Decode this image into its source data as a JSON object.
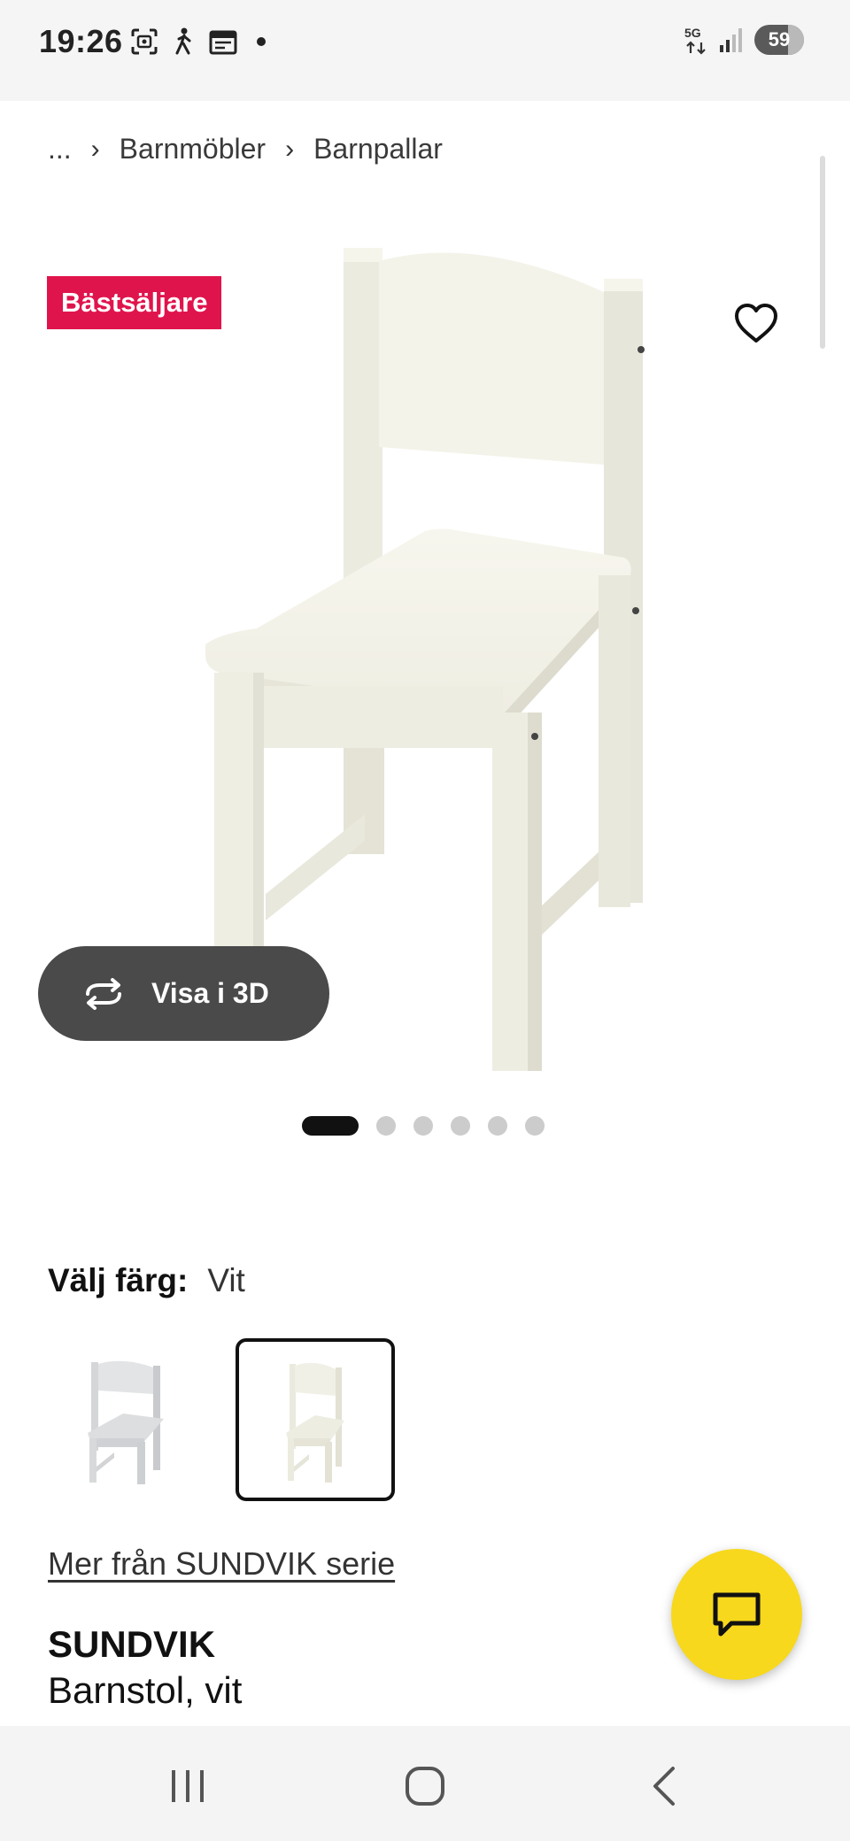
{
  "status_bar": {
    "time": "19:26",
    "network": "5G",
    "battery": "59",
    "icons": [
      "screenshot-icon",
      "accessibility-icon",
      "calendar-icon",
      "notification-dot-icon",
      "signal-icon"
    ]
  },
  "breadcrumb": {
    "ellipsis": "...",
    "items": [
      "Barnmöbler",
      "Barnpallar"
    ]
  },
  "product_image": {
    "badge": "Bästsäljare",
    "view_3d_label": "Visa i 3D",
    "carousel_count": 6,
    "carousel_active": 0
  },
  "color_picker": {
    "label": "Välj färg:",
    "value": "Vit",
    "options": [
      "grey chair",
      "white chair"
    ],
    "selected": 1
  },
  "series_link": "Mer från SUNDVIK serie",
  "product": {
    "name": "SUNDVIK",
    "description": "Barnstol, vit"
  },
  "colors": {
    "badge": "#e0144c",
    "chat_fab": "#f7d81c",
    "view3d_bg": "#4a4a4a"
  },
  "nav_bar": [
    "recent-apps-icon",
    "home-icon",
    "back-icon"
  ]
}
